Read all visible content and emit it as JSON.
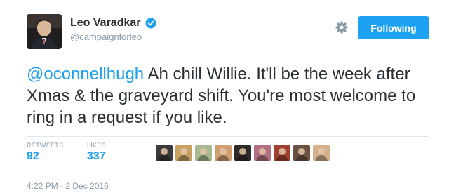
{
  "tweet": {
    "author": {
      "display_name": "Leo Varadkar",
      "screen_name": "@campaignforleo",
      "verified": true
    },
    "follow_button_label": "Following",
    "text": {
      "mention": "@oconnellhugh",
      "body": " Ah chill Willie. It'll be the week after Xmas & the graveyard shift. You're most welcome to ring in a request if you like."
    },
    "stats": {
      "retweets_label": "RETWEETS",
      "retweets_count": "92",
      "likes_label": "LIKES",
      "likes_count": "337"
    },
    "liker_avatar_colors": [
      "#3a3a3a",
      "#c8a060",
      "#a8b890",
      "#d0a070",
      "#2e2a28",
      "#b07080",
      "#a04030",
      "#6a5040",
      "#d2b08a"
    ],
    "timestamp": "4:22 PM - 2 Dec 2016"
  },
  "colors": {
    "accent": "#1da1f2",
    "text": "#292f33",
    "muted": "#8899a6",
    "divider": "#e1e8ed"
  }
}
